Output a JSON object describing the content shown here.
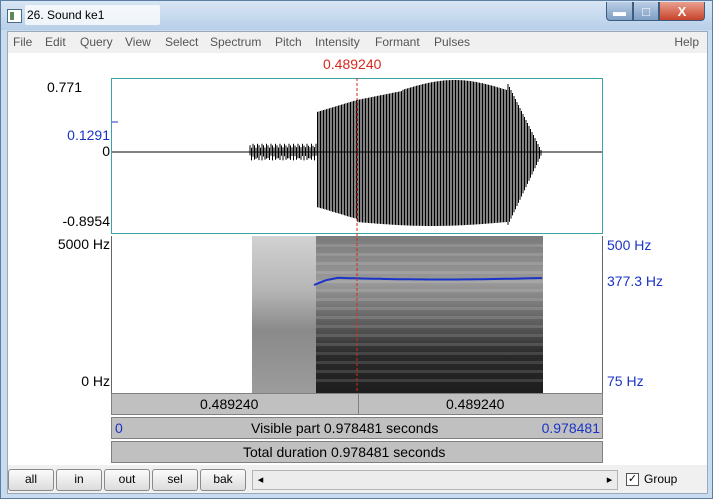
{
  "window": {
    "title": "26. Sound ke1"
  },
  "controls": {
    "minimize": "▬",
    "maximize": "□",
    "close": "X"
  },
  "menu": {
    "items": [
      "File",
      "Edit",
      "Query",
      "View",
      "Select",
      "Spectrum",
      "Pitch",
      "Intensity",
      "Formant",
      "Pulses"
    ],
    "help": "Help"
  },
  "cursor": {
    "time": "0.489240"
  },
  "waveform": {
    "max": "0.771",
    "marker": "0.1291",
    "zero": "0",
    "min": "-0.8954"
  },
  "spectrogram": {
    "top_freq": "5000 Hz",
    "bottom_freq": "0 Hz"
  },
  "pitch": {
    "top": "500 Hz",
    "value": "377.3 Hz",
    "bottom": "75 Hz"
  },
  "time_bars": {
    "left_segment": "0.489240",
    "right_segment": "0.489240",
    "visible_start": "0",
    "visible_label": "Visible part 0.978481 seconds",
    "visible_end": "0.978481",
    "total_label": "Total duration 0.978481 seconds"
  },
  "buttons": {
    "all": "all",
    "in": "in",
    "out": "out",
    "sel": "sel",
    "bak": "bak"
  },
  "scrollbar": {
    "left_arrow": "◂",
    "right_arrow": "▸"
  },
  "group": {
    "label": "Group",
    "checked": true,
    "check_mark": "✓"
  },
  "colors": {
    "cursor": "#d8281e",
    "pitch": "#1a33c8",
    "waveform_frame": "#38a6a6"
  }
}
